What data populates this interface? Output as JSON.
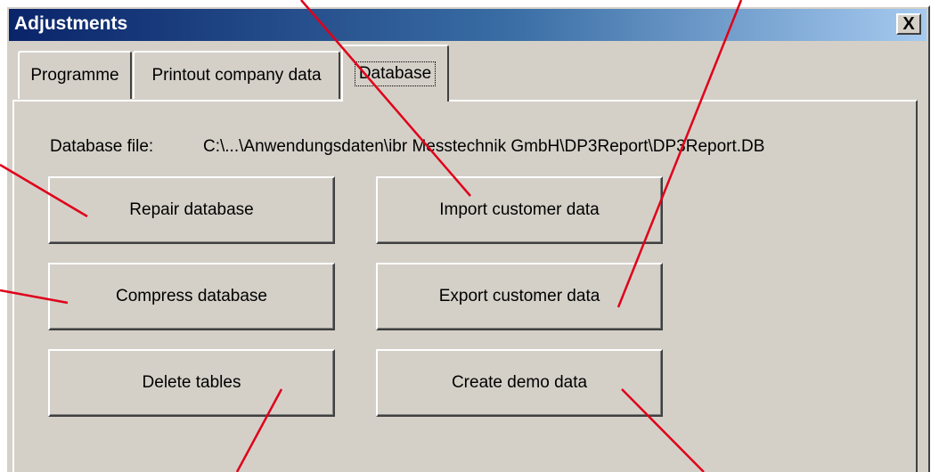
{
  "window": {
    "title": "Adjustments",
    "close_label": "X"
  },
  "tabs": [
    {
      "label": "Programme"
    },
    {
      "label": "Printout company data"
    },
    {
      "label": "Database"
    }
  ],
  "database": {
    "file_label": "Database file:",
    "file_path": "C:\\...\\Anwendungsdaten\\ibr Messtechnik GmbH\\DP3Report\\DP3Report.DB"
  },
  "buttons": {
    "repair": "Repair database",
    "compress": "Compress database",
    "delete": "Delete tables",
    "import": "Import customer data",
    "export": "Export customer data",
    "demo": "Create demo data"
  },
  "colors": {
    "annotation": "#e0001a",
    "title_bar_start": "#0a246a",
    "title_bar_end": "#a6caf0",
    "face": "#d4d0c8"
  }
}
